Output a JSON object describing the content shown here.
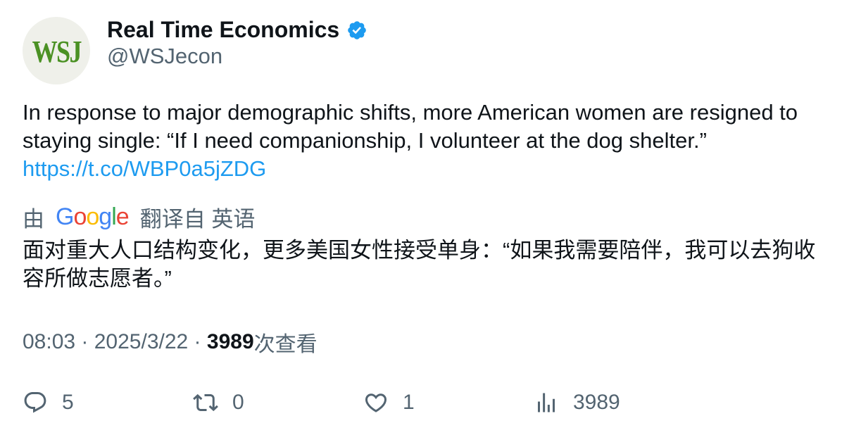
{
  "author": {
    "avatar_text": "WSJ",
    "display_name": "Real Time Economics",
    "handle": "@WSJecon",
    "verified": true,
    "verified_color": "#1d9bf0"
  },
  "tweet": {
    "text": "In response to major demographic shifts, more American women are resigned to staying single: “If I need companionship, I volunteer at the dog shelter.”",
    "link": "https://t.co/WBP0a5jZDG"
  },
  "translation": {
    "prefix": "由",
    "provider": "Google",
    "suffix": "翻译自 英语",
    "text": "面对重大人口结构变化，更多美国女性接受单身：“如果我需要陪伴，我可以去狗收容所做志愿者。”"
  },
  "meta": {
    "time": "08:03",
    "date": "2025/3/22",
    "views_count": "3989",
    "views_label": "次查看"
  },
  "actions": {
    "reply_count": "5",
    "retweet_count": "0",
    "like_count": "1",
    "views_count": "3989"
  },
  "colors": {
    "text_primary": "#0f1419",
    "text_secondary": "#536471",
    "link": "#1d9bf0",
    "avatar_bg": "#eff0ea",
    "avatar_text": "#4b9124"
  },
  "icons": {
    "verified": "verified-badge-icon",
    "reply": "reply-bubble-icon",
    "retweet": "retweet-arrows-icon",
    "like": "heart-icon",
    "views": "bar-chart-icon"
  }
}
